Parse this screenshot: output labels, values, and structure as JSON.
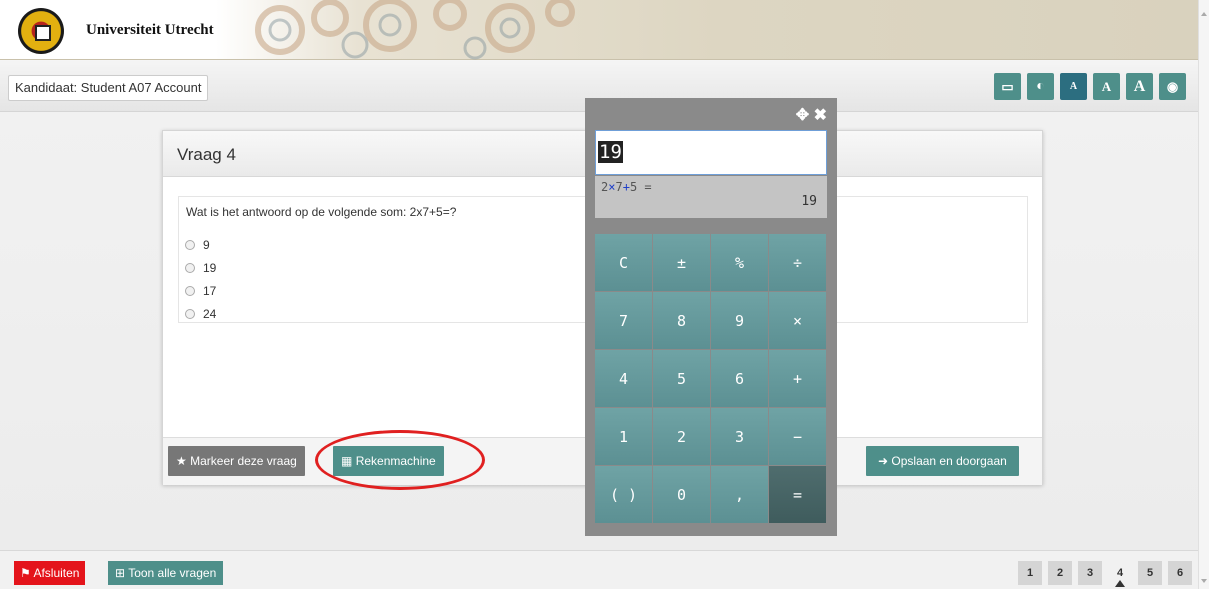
{
  "header": {
    "institution": "Universiteit Utrecht",
    "logo_icon": "university-seal",
    "decoration": "gears-lightbulb-banner"
  },
  "toolbar": {
    "candidate_label": "Kandidaat: Student A07 Account",
    "tools": [
      {
        "name": "screen-icon",
        "glyph": "▭"
      },
      {
        "name": "contrast-icon",
        "glyph": "◐"
      },
      {
        "name": "font-small-icon",
        "glyph": "A"
      },
      {
        "name": "font-medium-icon",
        "glyph": "A"
      },
      {
        "name": "font-large-icon",
        "glyph": "A"
      },
      {
        "name": "globe-icon",
        "glyph": "◉"
      }
    ]
  },
  "question": {
    "title": "Vraag 4",
    "text": "Wat is het antwoord op de volgende som: 2x7+5=?",
    "options": [
      "9",
      "19",
      "17",
      "24"
    ]
  },
  "footer": {
    "mark_label": "Markeer deze vraag",
    "calc_label": "Rekenmachine",
    "save_label": "Opslaan en doorgaan"
  },
  "calculator": {
    "move_icon": "✥",
    "close_icon": "✖",
    "display": "19",
    "expression_parts": [
      "2",
      "×",
      "7",
      "+",
      "5",
      " ="
    ],
    "result": "19",
    "keys": [
      "C",
      "±",
      "%",
      "÷",
      "7",
      "8",
      "9",
      "×",
      "4",
      "5",
      "6",
      "+",
      "1",
      "2",
      "3",
      "−",
      "( )",
      "0",
      ",",
      "="
    ]
  },
  "bottom": {
    "quit_label": "Afsluiten",
    "all_questions_label": "Toon alle vragen",
    "pages": [
      "1",
      "2",
      "3",
      "4",
      "5",
      "6"
    ],
    "current_page": "4"
  },
  "colors": {
    "accent": "#4e8f8a",
    "danger": "#e4141b",
    "calculator_bg": "#8a8a8a"
  }
}
